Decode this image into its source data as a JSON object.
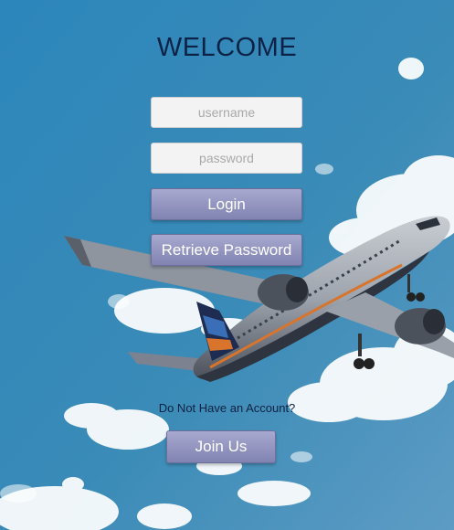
{
  "page": {
    "title": "WELCOME"
  },
  "form": {
    "username_placeholder": "username",
    "password_placeholder": "password",
    "login_label": "Login",
    "retrieve_label": "Retrieve Password"
  },
  "signup": {
    "prompt": "Do Not Have an Account?",
    "join_label": "Join Us"
  },
  "colors": {
    "title": "#0c2347",
    "button": "#8f90be",
    "sky": "#2f7fb0"
  }
}
